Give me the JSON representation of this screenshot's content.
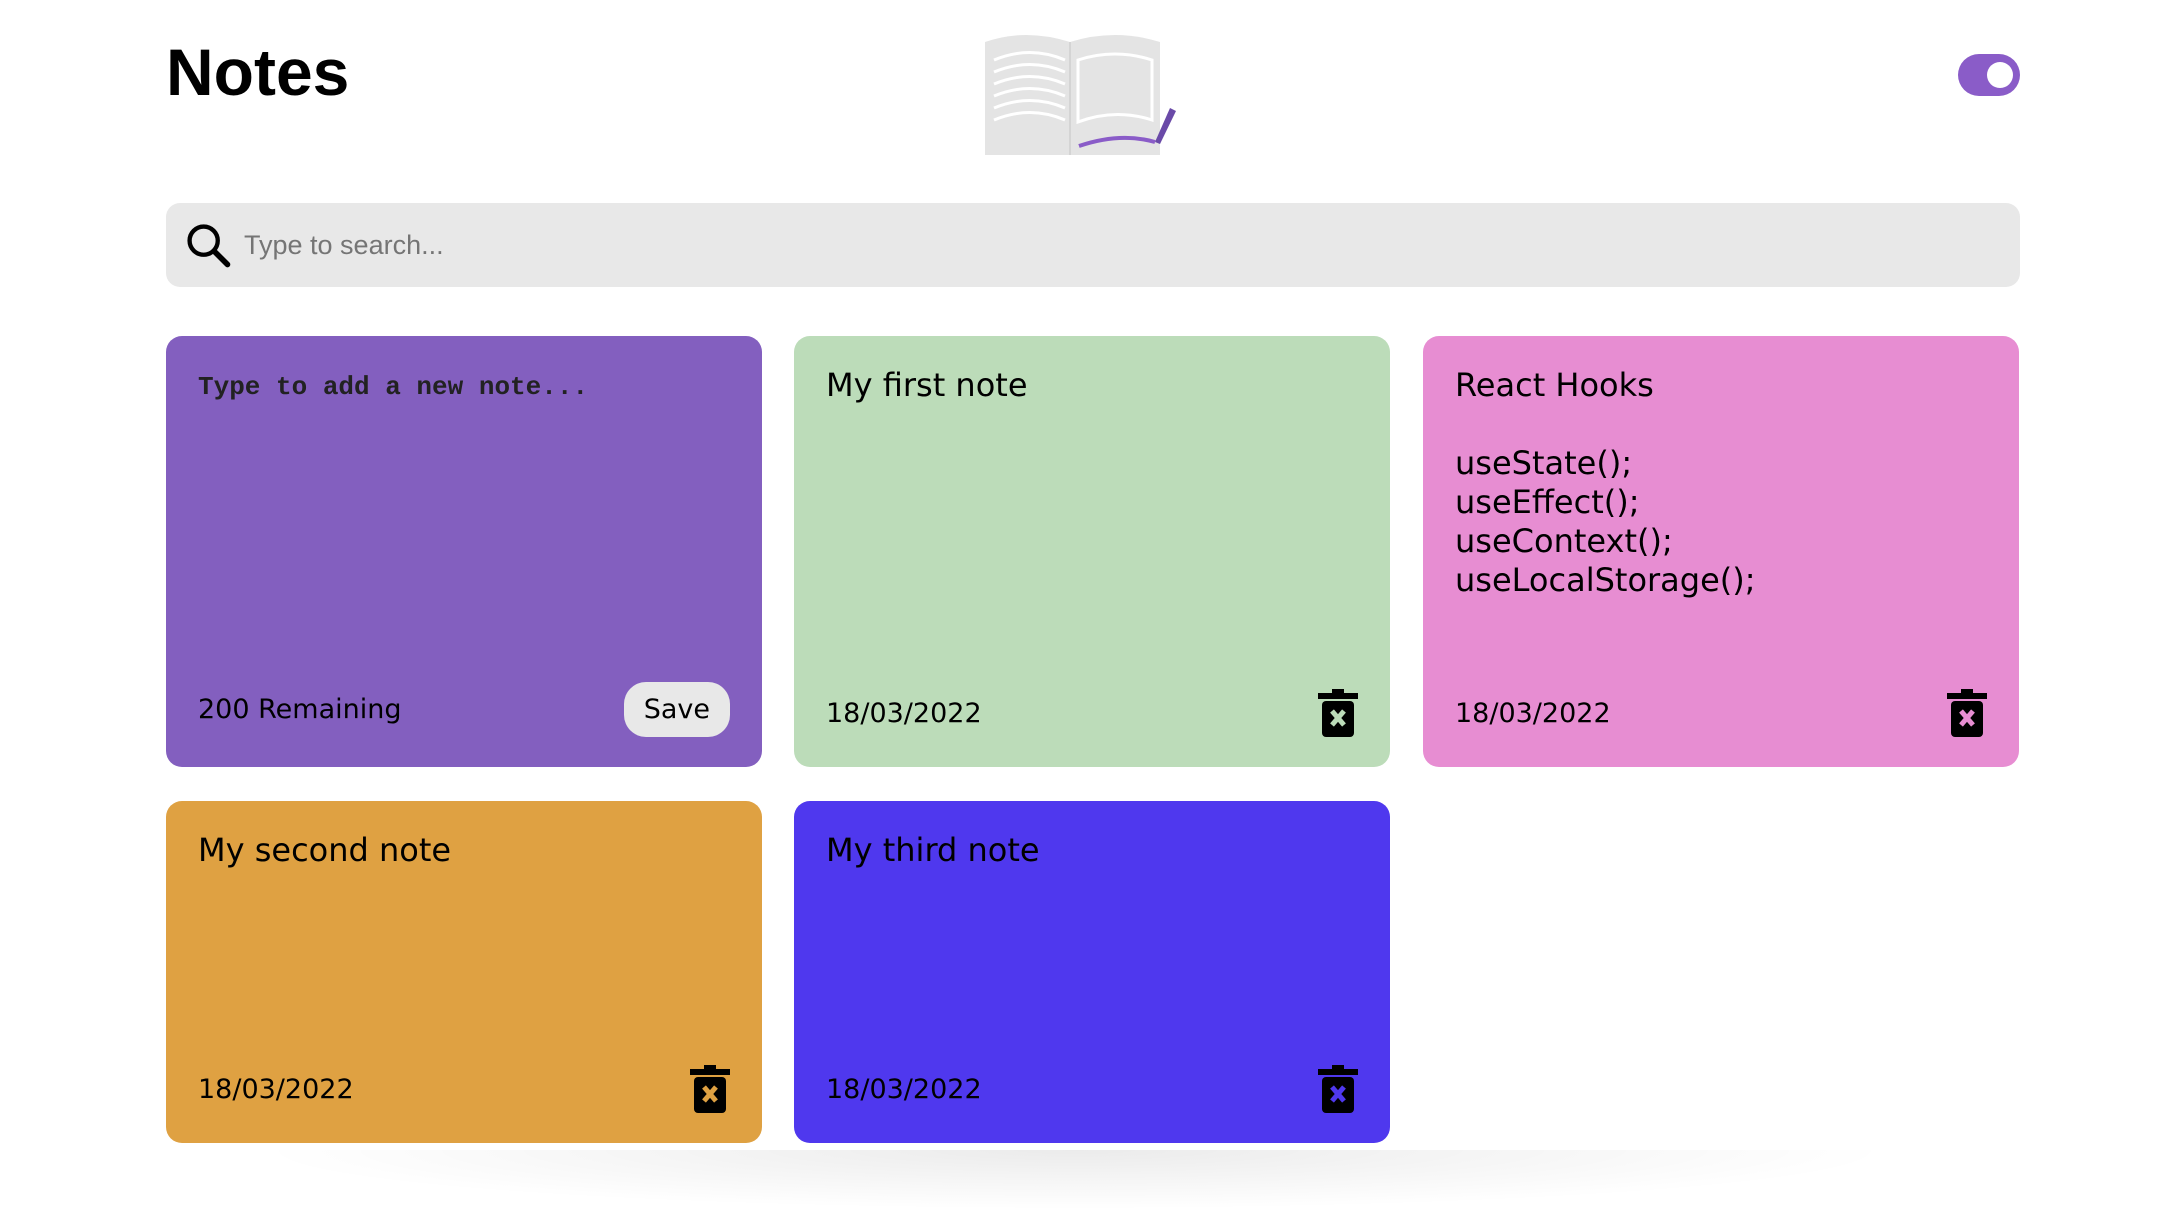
{
  "header": {
    "title": "Notes",
    "toggle_on": true
  },
  "search": {
    "placeholder": "Type to search..."
  },
  "new_note": {
    "placeholder": "Type to add a new note...",
    "remaining": "200 Remaining",
    "save_label": "Save",
    "color": "#835fbf"
  },
  "notes": [
    {
      "text": "My first note",
      "date": "18/03/2022",
      "color": "#bcdcb9"
    },
    {
      "text": "React Hooks\n\nuseState();\nuseEffect();\nuseContext();\nuseLocalStorage();",
      "date": "18/03/2022",
      "color": "#e78dd2"
    },
    {
      "text": "My second note",
      "date": "18/03/2022",
      "color": "#dfa142"
    },
    {
      "text": "My third note",
      "date": "18/03/2022",
      "color": "#4f38ee"
    }
  ]
}
